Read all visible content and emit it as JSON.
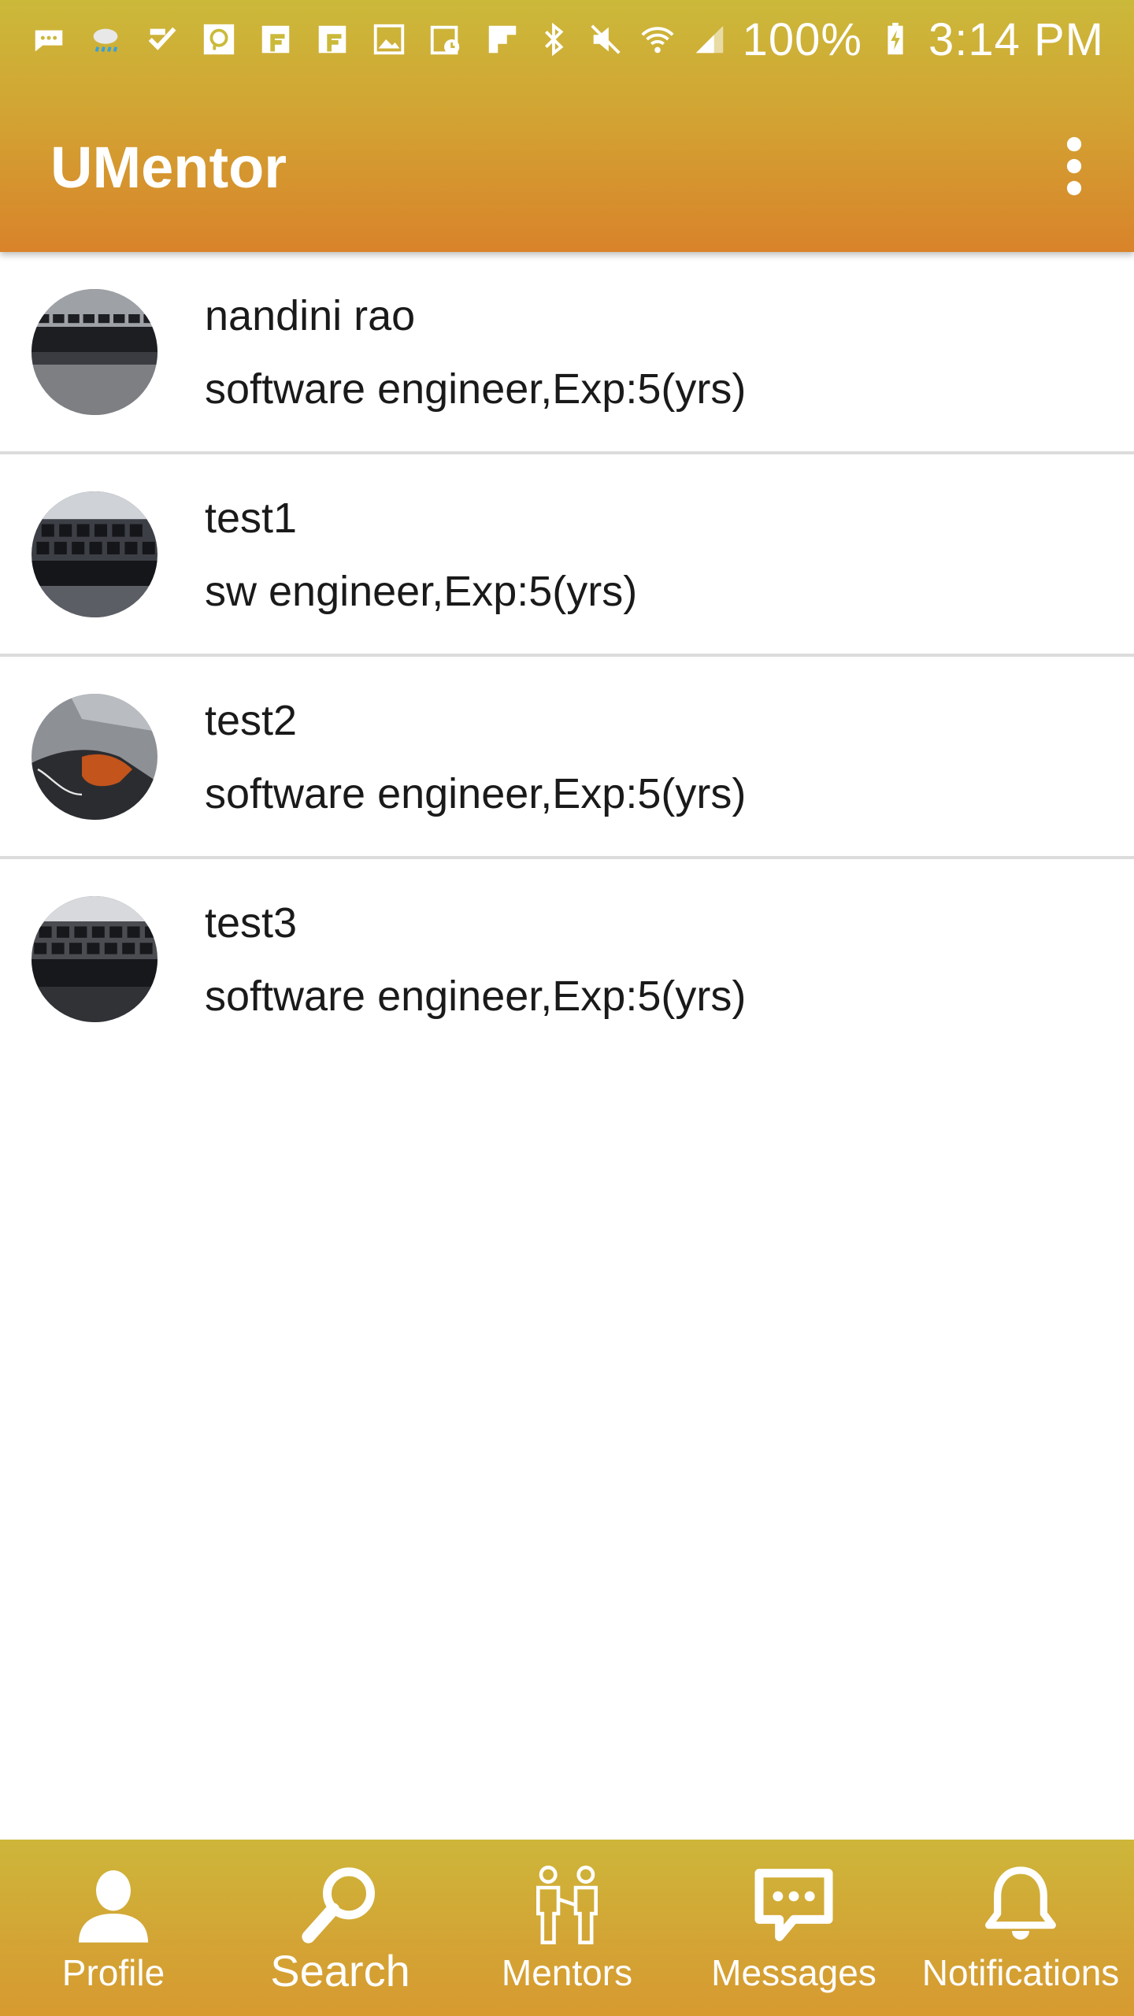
{
  "status_bar": {
    "battery": "100%",
    "time": "3:14 PM",
    "icons": [
      "message-icon",
      "weather-icon",
      "check-icon",
      "chat-bubble-icon",
      "flipboard-icon",
      "flipboard-icon-2",
      "image-icon",
      "calendar-icon",
      "flipboard-red-icon",
      "bluetooth-icon",
      "mute-icon",
      "wifi-icon",
      "signal-icon",
      "battery-icon"
    ]
  },
  "app_bar": {
    "title": "UMentor",
    "menu_icon": "more-vert-icon"
  },
  "mentors": [
    {
      "name": "nandini rao",
      "description": "software engineer,Exp:5(yrs)"
    },
    {
      "name": "test1",
      "description": "sw engineer,Exp:5(yrs)"
    },
    {
      "name": "test2",
      "description": "software engineer,Exp:5(yrs)"
    },
    {
      "name": "test3",
      "description": "software engineer,Exp:5(yrs)"
    }
  ],
  "bottom_nav": {
    "items": [
      {
        "label": "Profile",
        "icon": "person-icon"
      },
      {
        "label": "Search",
        "icon": "search-icon",
        "active": true
      },
      {
        "label": "Mentors",
        "icon": "mentors-icon"
      },
      {
        "label": "Messages",
        "icon": "message-bubble-icon"
      },
      {
        "label": "Notifications",
        "icon": "bell-icon"
      }
    ]
  },
  "colors": {
    "bar_top": "#cbb93a",
    "bar_bottom": "#d9832a",
    "nav_bg": "#d3a535",
    "divider": "#dcdcdc"
  }
}
